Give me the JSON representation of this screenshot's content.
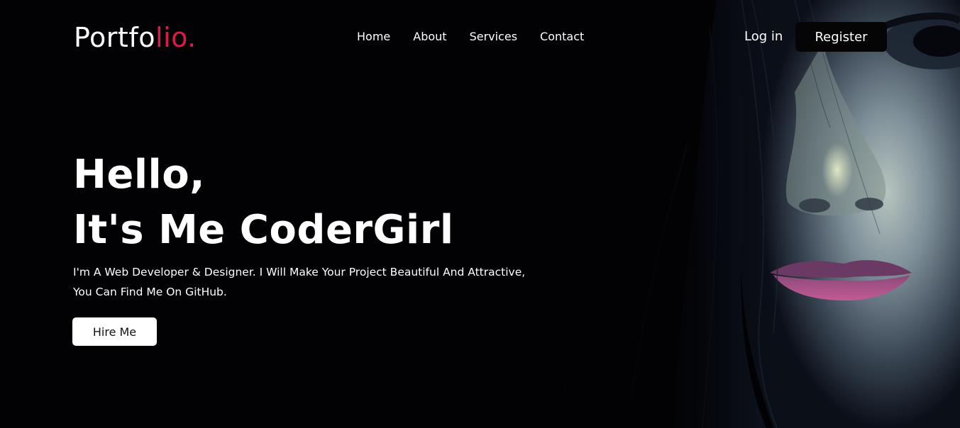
{
  "header": {
    "logo_main": "Portfo",
    "logo_accent": "lio.",
    "nav": [
      {
        "label": "Home"
      },
      {
        "label": "About"
      },
      {
        "label": "Services"
      },
      {
        "label": "Contact"
      }
    ],
    "login_label": "Log in",
    "register_label": "Register"
  },
  "hero": {
    "title_line1": "Hello,",
    "title_line2": "It's Me CoderGirl",
    "desc_line1": "I'm A Web Developer & Designer. I Will Make Your Project Beautiful And Attractive,",
    "desc_line2": "You Can Find Me On GitHub.",
    "cta_label": "Hire Me"
  },
  "colors": {
    "background": "#020204",
    "accent": "#e0174b",
    "text": "#ffffff",
    "cta_background": "#ffffff",
    "register_background": "#050505"
  },
  "images": {
    "hero_photo": "portrait-woman-face"
  }
}
